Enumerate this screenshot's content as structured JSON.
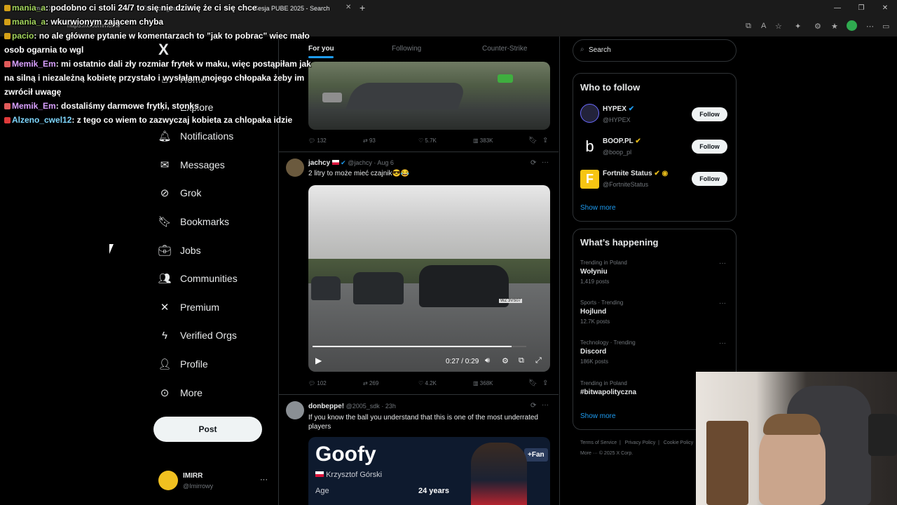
{
  "browser": {
    "tabs": [
      "Home / X",
      "IEM Cologne 2025",
      "Sesja PUBE 2025 - Search"
    ],
    "url": "https://x.com/home"
  },
  "nav": {
    "logo": "X",
    "items": [
      {
        "label": "Home",
        "icon": "home-icon"
      },
      {
        "label": "Explore",
        "icon": "search-icon"
      },
      {
        "label": "Notifications",
        "icon": "bell-icon"
      },
      {
        "label": "Messages",
        "icon": "mail-icon"
      },
      {
        "label": "Grok",
        "icon": "grok-icon"
      },
      {
        "label": "Bookmarks",
        "icon": "bookmark-icon"
      },
      {
        "label": "Jobs",
        "icon": "briefcase-icon"
      },
      {
        "label": "Communities",
        "icon": "people-icon"
      },
      {
        "label": "Premium",
        "icon": "x-icon"
      },
      {
        "label": "Verified Orgs",
        "icon": "lightning-icon"
      },
      {
        "label": "Profile",
        "icon": "person-icon"
      },
      {
        "label": "More",
        "icon": "more-circle-icon"
      }
    ],
    "post_label": "Post",
    "account": {
      "name": "IMIRR",
      "handle": "@Imirrowy"
    }
  },
  "feed": {
    "tabs": [
      "For you",
      "Following",
      "Counter-Strike"
    ],
    "post1": {
      "replies": "132",
      "reposts": "93",
      "likes": "5.7K",
      "views": "383K"
    },
    "post2": {
      "name": "jachcy",
      "handle": "@jachcy",
      "date": "Aug 6",
      "text": "2 litry to może mieć czajnik😎😂",
      "video_time": "0:27 / 0:29",
      "video_progress": 0.93,
      "plate": "WZ 3VS07",
      "replies": "102",
      "reposts": "269",
      "likes": "4.2K",
      "views": "368K"
    },
    "post3": {
      "name": "donbeppe!",
      "handle": "@2005_sdk",
      "date": "23h",
      "text": "If you know the ball you understand that this is one of the most underrated players",
      "card_title": "Goofy",
      "card_fan": "+Fan",
      "card_player": "Krzysztof Górski",
      "card_age_label": "Age",
      "card_age_value": "24 years"
    }
  },
  "right": {
    "search_placeholder": "Search",
    "who_title": "Who to follow",
    "follow_label": "Follow",
    "who": [
      {
        "name": "HYPEX",
        "handle": "@HYPEX"
      },
      {
        "name": "BOOP.PL",
        "handle": "@boop_pl"
      },
      {
        "name": "Fortnite Status",
        "handle": "@FortniteStatus"
      }
    ],
    "show_more": "Show more",
    "trend_title": "What’s happening",
    "trends": [
      {
        "category": "Trending in Poland",
        "name": "Wołyniu",
        "posts": "1,419 posts"
      },
      {
        "category": "Sports · Trending",
        "name": "Hojlund",
        "posts": "12.7K posts"
      },
      {
        "category": "Technology · Trending",
        "name": "Discord",
        "posts": "186K posts"
      },
      {
        "category": "Trending in Poland",
        "name": "#bitwapolityczna",
        "posts": ""
      }
    ],
    "footer": [
      "Terms of Service",
      "Privacy Policy",
      "Cookie Policy"
    ],
    "footer2": "More ··· © 2025 X Corp."
  },
  "chat": [
    {
      "user": "mania_a",
      "text": "podobno ci stoli 24/7 to się nie dziwię że ci się chce",
      "color": "#a4d65e"
    },
    {
      "user": "mania_a",
      "text": "wkurwionym zającem chyba",
      "color": "#a4d65e"
    },
    {
      "user": "pacio",
      "text": "no ale główne pytanie w komentarzach to \"jak to pobrac\" wiec mało",
      "color": "#a4d65e"
    },
    {
      "user": "",
      "text": "osob ogarnia to wgl",
      "color": "#fff"
    },
    {
      "user": "Memik_Em",
      "text": "mi ostatnio dali zły rozmiar frytek w maku, więc postąpiłam jak",
      "color": "#d9a0ff"
    },
    {
      "user": "",
      "text": "na silną i niezależną kobietę przystało i wysłałam mojego chłopaka żeby im",
      "color": "#fff"
    },
    {
      "user": "",
      "text": "zwrócił uwagę",
      "color": "#fff"
    },
    {
      "user": "Memik_Em",
      "text": "dostaliśmy darmowe frytki, stonks",
      "color": "#d9a0ff"
    },
    {
      "user": "Alzeno_cwel12",
      "text": "z tego co wiem to zazwyczaj kobieta za chlopaka idzie",
      "color": "#7fd7ff"
    }
  ],
  "colors": {
    "accent": "#1d9bf0",
    "verified_gold": "#e2b719",
    "background": "#000000"
  }
}
